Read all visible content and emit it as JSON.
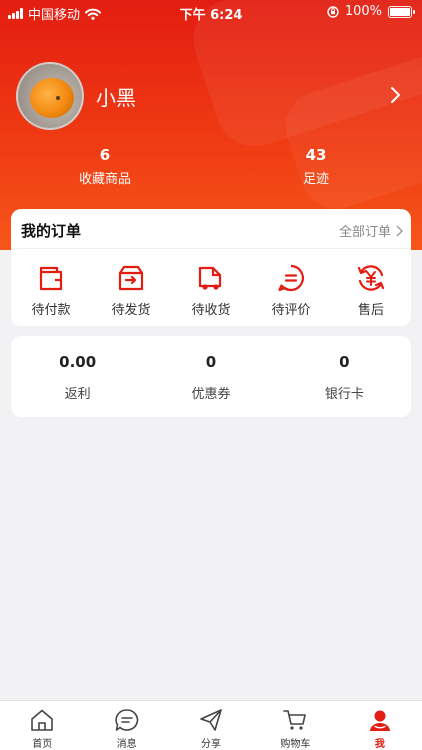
{
  "status_bar": {
    "carrier": "中国移动",
    "time": "下午 6:24",
    "battery": "100%"
  },
  "profile": {
    "username": "小黑"
  },
  "stats": [
    {
      "value": "6",
      "label": "收藏商品"
    },
    {
      "value": "43",
      "label": "足迹"
    }
  ],
  "orders": {
    "title": "我的订单",
    "all_label": "全部订单",
    "items": [
      {
        "label": "待付款",
        "icon": "wallet-icon"
      },
      {
        "label": "待发货",
        "icon": "box-icon"
      },
      {
        "label": "待收货",
        "icon": "truck-icon"
      },
      {
        "label": "待评价",
        "icon": "comment-icon"
      },
      {
        "label": "售后",
        "icon": "yuan-refund-icon"
      }
    ]
  },
  "assets": [
    {
      "value": "0.00",
      "label": "返利"
    },
    {
      "value": "0",
      "label": "优惠券"
    },
    {
      "value": "0",
      "label": "银行卡"
    }
  ],
  "tabs": [
    {
      "label": "首页",
      "icon": "home-icon"
    },
    {
      "label": "消息",
      "icon": "chat-icon"
    },
    {
      "label": "分享",
      "icon": "send-icon"
    },
    {
      "label": "购物车",
      "icon": "cart-icon"
    },
    {
      "label": "我",
      "icon": "user-icon",
      "active": true
    }
  ],
  "colors": {
    "accent": "#e31d12",
    "header_bottom": "#f6561a"
  }
}
